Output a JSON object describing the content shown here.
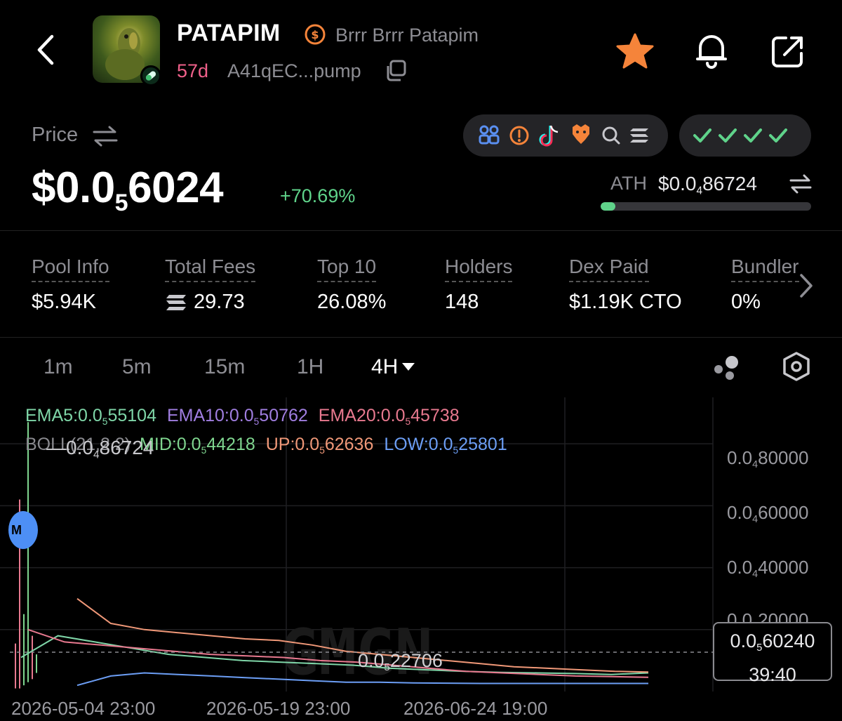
{
  "header": {
    "title": "PATAPIM",
    "subtitle": "Brrr Brrr Patapim",
    "age": "57d",
    "contract": "A41qEC...pump"
  },
  "price": {
    "label": "Price",
    "value_prefix": "$0.0",
    "value_sub": "5",
    "value_rest": "6024",
    "change": "+70.69%",
    "ath_label": "ATH",
    "ath_prefix": "$0.0",
    "ath_sub": "4",
    "ath_rest": "86724",
    "ath_progress": 0.07
  },
  "colors": {
    "accent_green": "#5fd38a",
    "star_orange": "#f5843a",
    "age_pink": "#f0608a",
    "ema5": "#7fd6a8",
    "ema10": "#a07ee0",
    "ema20": "#e8798f",
    "boll_mid": "#7fd68f",
    "boll_up": "#f09878",
    "boll_low": "#6c9ef5"
  },
  "social_icons": [
    "people-icon",
    "warning-icon",
    "tiktok-icon",
    "eagle-icon",
    "search-icon",
    "solana-icon"
  ],
  "checks": [
    "check",
    "check",
    "check",
    "check"
  ],
  "stats": [
    {
      "label": "Pool Info",
      "value": "$5.94K"
    },
    {
      "label": "Total Fees",
      "value": "29.73",
      "icon": "solana-icon"
    },
    {
      "label": "Top 10",
      "value": "26.08%"
    },
    {
      "label": "Holders",
      "value": "148"
    },
    {
      "label": "Dex Paid",
      "value": "$1.19K CTO"
    },
    {
      "label": "Bundler",
      "value": "0%"
    }
  ],
  "timeframes": [
    "1m",
    "5m",
    "15m",
    "1H",
    "4H"
  ],
  "active_timeframe": "4H",
  "chart_data": {
    "type": "line",
    "indicators": {
      "ema5": {
        "label": "EMA5:",
        "pre": "0.0",
        "sub": "5",
        "rest": "55104"
      },
      "ema10": {
        "label": "EMA10:",
        "pre": "0.0",
        "sub": "5",
        "rest": "50762"
      },
      "ema20": {
        "label": "EMA20:",
        "pre": "0.0",
        "sub": "5",
        "rest": "45738"
      },
      "boll_label": "BOLL(21,2,2)",
      "mid": {
        "label": "MID:",
        "pre": "0.0",
        "sub": "5",
        "rest": "44218"
      },
      "up": {
        "label": "UP:",
        "pre": "0.0",
        "sub": "5",
        "rest": "62636"
      },
      "low": {
        "label": "LOW:",
        "pre": "0.0",
        "sub": "5",
        "rest": "25801"
      }
    },
    "y_ticks": [
      {
        "pre": "0.0",
        "sub": "4",
        "rest": "80000",
        "value": 8e-05
      },
      {
        "pre": "0.0",
        "sub": "4",
        "rest": "60000",
        "value": 6e-05
      },
      {
        "pre": "0.0",
        "sub": "4",
        "rest": "40000",
        "value": 4e-05
      },
      {
        "pre": "0.0",
        "sub": "4",
        "rest": "20000",
        "value": 2e-05
      }
    ],
    "x_ticks": [
      "2026-05-04 23:00",
      "2026-05-19 23:00",
      "2026-06-24 19:00"
    ],
    "high_marker": {
      "pre": "0.0",
      "sub": "4",
      "rest": "86724"
    },
    "low_marker": {
      "pre": "0.0",
      "sub": "5",
      "rest": "22706"
    },
    "current": {
      "pre": "0.0",
      "sub": "5",
      "rest": "60240",
      "countdown": "39:40"
    },
    "marker": "M",
    "ylim": [
      0,
      9.5e-05
    ],
    "series": [
      {
        "name": "EMA5",
        "values": [
          1.1e-05,
          1.8e-05,
          1.6e-05,
          1.4e-05,
          1.2e-05,
          1.1e-05,
          1e-05,
          9.5e-06,
          9e-06,
          8.5e-06,
          7.5e-06,
          7e-06,
          6.5e-06,
          6.2e-06,
          6e-06,
          5.8e-06,
          5.5e-06,
          6e-06
        ]
      },
      {
        "name": "EMA20",
        "values": [
          2e-05,
          1.6e-05,
          1.5e-05,
          1.4e-05,
          1.3e-05,
          1.2e-05,
          1.15e-05,
          1.1e-05,
          1e-05,
          9.5e-06,
          8.5e-06,
          7.5e-06,
          6.5e-06,
          6e-06,
          5.5e-06,
          5e-06,
          4.8e-06,
          4.6e-06
        ]
      },
      {
        "name": "BOLL UP",
        "values": [
          3e-05,
          2.2e-05,
          2e-05,
          1.9e-05,
          1.8e-05,
          1.7e-05,
          1.65e-05,
          1.5e-05,
          1.3e-05,
          1.2e-05,
          1.1e-05,
          1e-05,
          9e-06,
          8e-06,
          7.5e-06,
          7e-06,
          6.5e-06,
          6.3e-06
        ]
      },
      {
        "name": "BOLL LOW",
        "values": [
          2e-06,
          5e-06,
          6e-06,
          5.5e-06,
          5e-06,
          4.5e-06,
          4e-06,
          3.5e-06,
          3e-06,
          3e-06,
          2.8e-06,
          2.7e-06,
          2.6e-06,
          2.6e-06,
          2.6e-06,
          2.6e-06,
          2.6e-06,
          2.6e-06
        ]
      }
    ]
  }
}
